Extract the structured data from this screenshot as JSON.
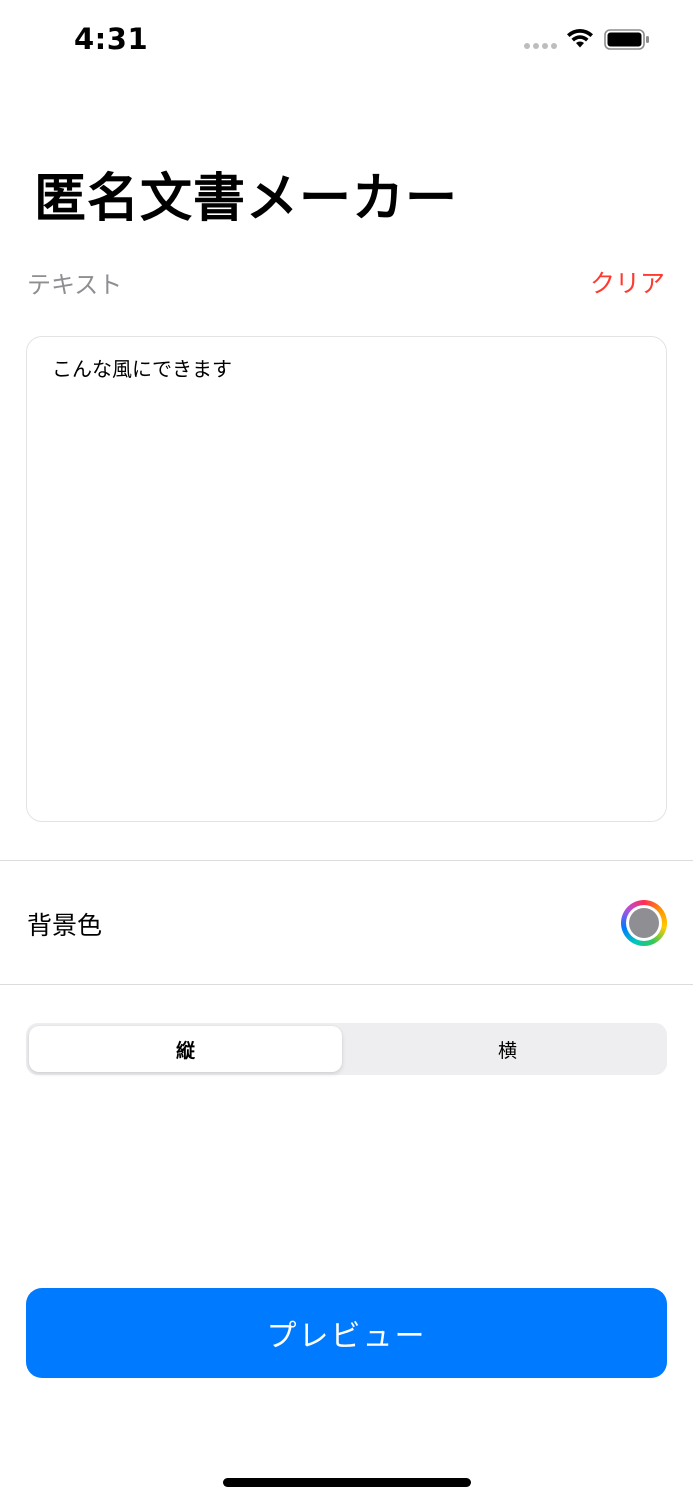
{
  "status_bar": {
    "time": "4:31"
  },
  "title": "匿名文書メーカー",
  "text_section": {
    "label": "テキスト",
    "clear_label": "クリア",
    "text_value": "こんな風にできます"
  },
  "background_color": {
    "label": "背景色",
    "selected_color": "#8e8e93"
  },
  "orientation": {
    "options": [
      "縦",
      "横"
    ],
    "selected": "縦"
  },
  "preview_button": {
    "label": "プレビュー"
  },
  "colors": {
    "accent": "#007aff",
    "destructive": "#ff3b30"
  },
  "icons": [
    "wifi-icon",
    "battery-icon",
    "signal-icon",
    "color-picker-icon"
  ]
}
